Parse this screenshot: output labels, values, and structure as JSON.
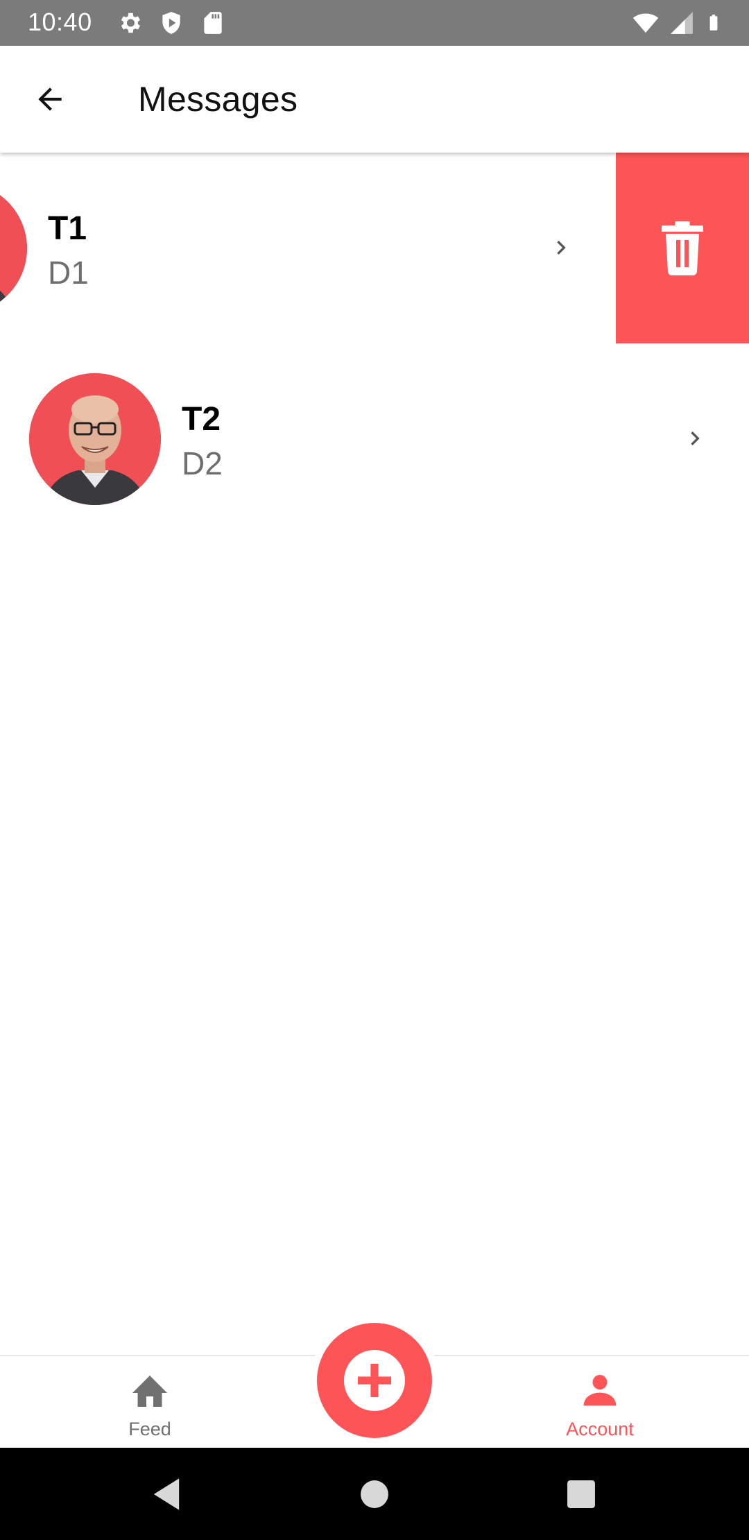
{
  "status_bar": {
    "time": "10:40",
    "left_icons": [
      "settings-icon",
      "shield-icon",
      "sd-card-icon"
    ],
    "right_icons": [
      "wifi-icon",
      "signal-icon",
      "battery-icon"
    ]
  },
  "header": {
    "title": "Messages",
    "back_icon": "arrow-left-icon"
  },
  "messages": [
    {
      "title": "T1",
      "subtitle": "D1",
      "swiped": true,
      "action": "delete"
    },
    {
      "title": "T2",
      "subtitle": "D2",
      "swiped": false
    }
  ],
  "bottom_nav": {
    "items": [
      {
        "label": "Feed",
        "icon": "home-icon",
        "active": false
      },
      {
        "label": "Account",
        "icon": "person-icon",
        "active": true
      }
    ],
    "fab_icon": "plus-icon"
  },
  "system_nav": [
    "back-triangle-icon",
    "home-circle-icon",
    "recents-square-icon"
  ],
  "colors": {
    "accent": "#fc5457",
    "status_bar": "#7b7b7b",
    "subtitle": "#6e6e6e",
    "inactive_nav": "#707070"
  }
}
